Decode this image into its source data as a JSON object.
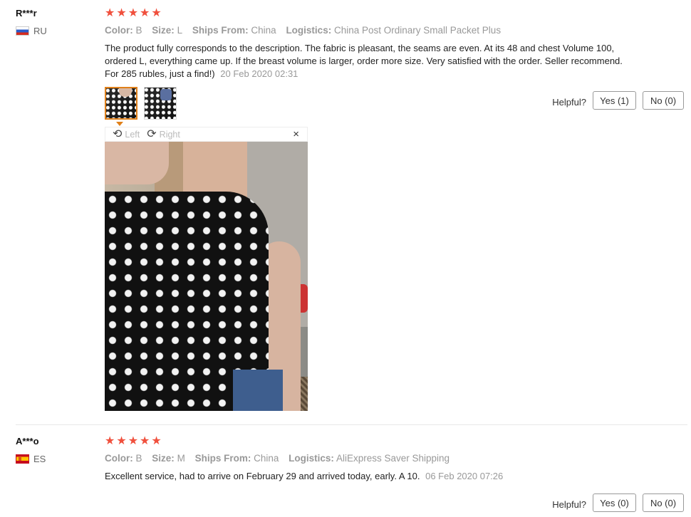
{
  "reviews": [
    {
      "user": "R***r",
      "country": "RU",
      "stars": [
        "★",
        "★",
        "★",
        "★",
        "★"
      ],
      "attrs": {
        "color_key": "Color:",
        "color_val": "B",
        "size_key": "Size:",
        "size_val": "L",
        "ships_key": "Ships From:",
        "ships_val": "China",
        "logistics_key": "Logistics:",
        "logistics_val": "China Post Ordinary Small Packet Plus"
      },
      "text": "The product fully corresponds to the description. The fabric is pleasant, the seams are even. At its 48 and chest Volume 100, ordered L, everything came up. If the breast volume is larger, order more size. Very satisfied with the order. Seller recommend. For 285 rubles, just a find!)",
      "date": "20 Feb 2020 02:31",
      "helpful": "Helpful?",
      "yes": "Yes (1)",
      "no": "No (0)",
      "viewer": {
        "left": "Left",
        "right": "Right",
        "close": "×"
      }
    },
    {
      "user": "A***o",
      "country": "ES",
      "stars": [
        "★",
        "★",
        "★",
        "★",
        "★"
      ],
      "attrs": {
        "color_key": "Color:",
        "color_val": "B",
        "size_key": "Size:",
        "size_val": "M",
        "ships_key": "Ships From:",
        "ships_val": "China",
        "logistics_key": "Logistics:",
        "logistics_val": "AliExpress Saver Shipping"
      },
      "text": "Excellent service, had to arrive on February 29 and arrived today, early. A 10.",
      "date": "06 Feb 2020 07:26",
      "helpful": "Helpful?",
      "yes": "Yes (0)",
      "no": "No (0)"
    }
  ],
  "colors": {
    "star": "#f0503d",
    "accent": "#e0801a",
    "muted": "#999999"
  },
  "icons": {
    "rotate_left": "rotate-left-icon",
    "rotate_right": "rotate-right-icon",
    "close": "close-icon"
  }
}
